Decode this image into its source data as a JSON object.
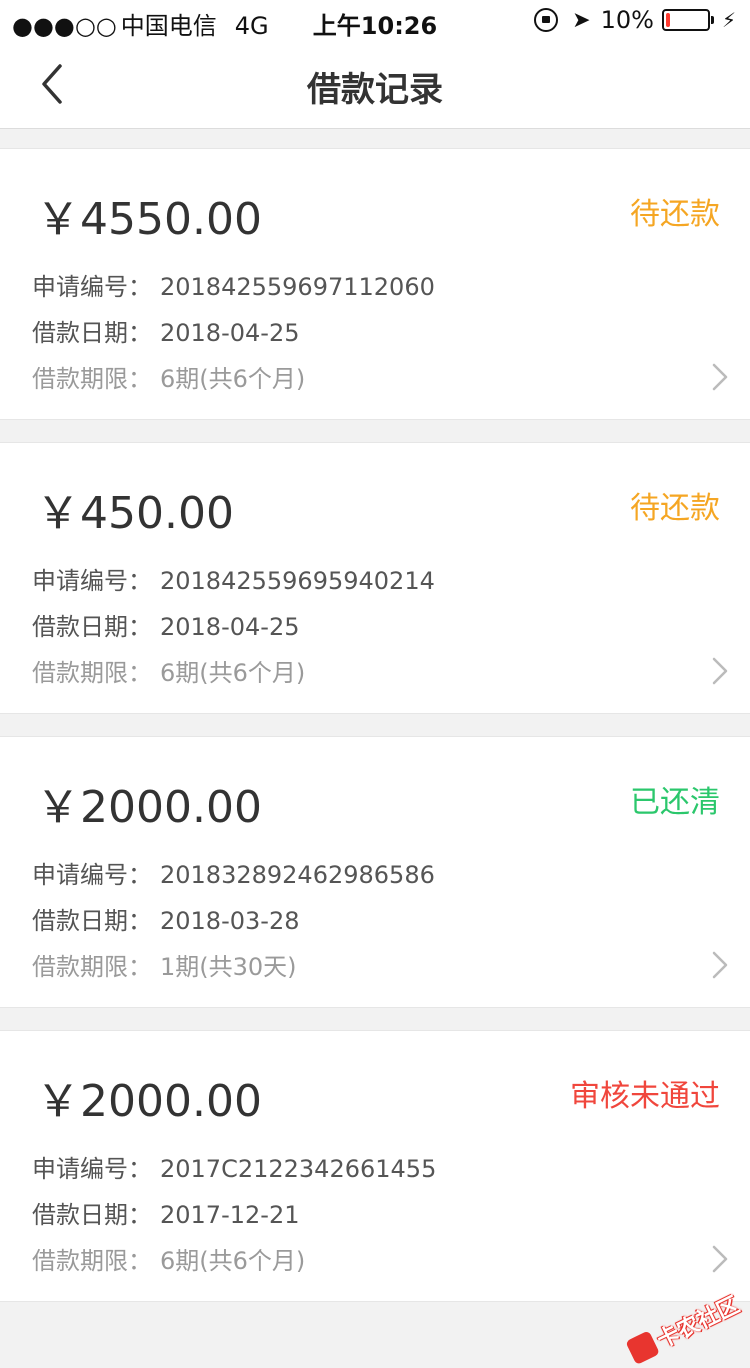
{
  "status_bar": {
    "signal": "●●●○○",
    "carrier": "中国电信",
    "network": "4G",
    "time": "上午10:26",
    "battery": "10%",
    "battery_level": 0.1
  },
  "nav": {
    "title": "借款记录"
  },
  "labels": {
    "apply_no": "申请编号：",
    "loan_date": "借款日期：",
    "loan_term": "借款期限："
  },
  "colors": {
    "pending": "#f5a623",
    "cleared": "#2bc76c",
    "rejected": "#f0463c"
  },
  "records": [
    {
      "amount": "￥4550.00",
      "status": "待还款",
      "status_type": "pending",
      "apply_no": "201842559697112060",
      "date": "2018-04-25",
      "term": "6期(共6个月)"
    },
    {
      "amount": "￥450.00",
      "status": "待还款",
      "status_type": "pending",
      "apply_no": "201842559695940214",
      "date": "2018-04-25",
      "term": "6期(共6个月)"
    },
    {
      "amount": "￥2000.00",
      "status": "已还清",
      "status_type": "cleared",
      "apply_no": "201832892462986586",
      "date": "2018-03-28",
      "term": "1期(共30天)"
    },
    {
      "amount": "￥2000.00",
      "status": "审核未通过",
      "status_type": "rejected",
      "apply_no": "2017C2122342661455",
      "date": "2017-12-21",
      "term": "6期(共6个月)"
    }
  ],
  "watermark": {
    "text": "卡农社区"
  }
}
